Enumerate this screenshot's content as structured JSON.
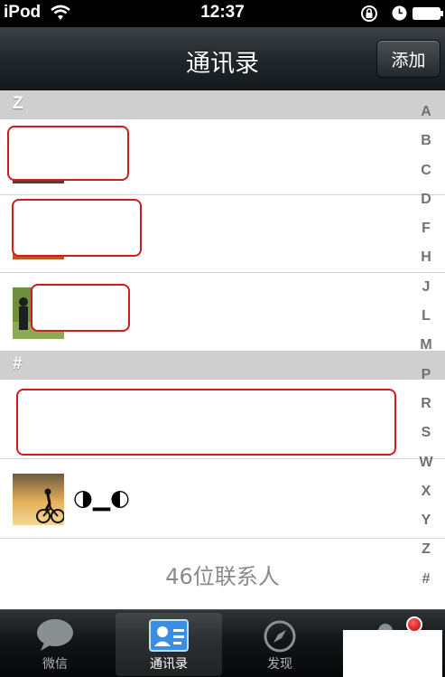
{
  "status_bar": {
    "carrier": "iPod",
    "time": "12:37"
  },
  "nav": {
    "title": "通讯录",
    "add_button": "添加"
  },
  "sections": [
    {
      "header": "Z"
    },
    {
      "header": "#"
    }
  ],
  "contacts": [
    {
      "name": "◑▁◐"
    }
  ],
  "footer": {
    "contact_count": "46位联系人"
  },
  "index_letters": [
    "A",
    "B",
    "C",
    "D",
    "F",
    "H",
    "J",
    "L",
    "M",
    "P",
    "R",
    "S",
    "W",
    "X",
    "Y",
    "Z",
    "#"
  ],
  "tabs": [
    {
      "label": "微信",
      "icon": "chat-bubble-icon",
      "active": false
    },
    {
      "label": "通讯录",
      "icon": "contacts-card-icon",
      "active": true
    },
    {
      "label": "发现",
      "icon": "compass-icon",
      "active": false
    }
  ],
  "colors": {
    "accent": "#3a8ee6",
    "redaction": "#d01c1c",
    "badge": "#e00000"
  }
}
